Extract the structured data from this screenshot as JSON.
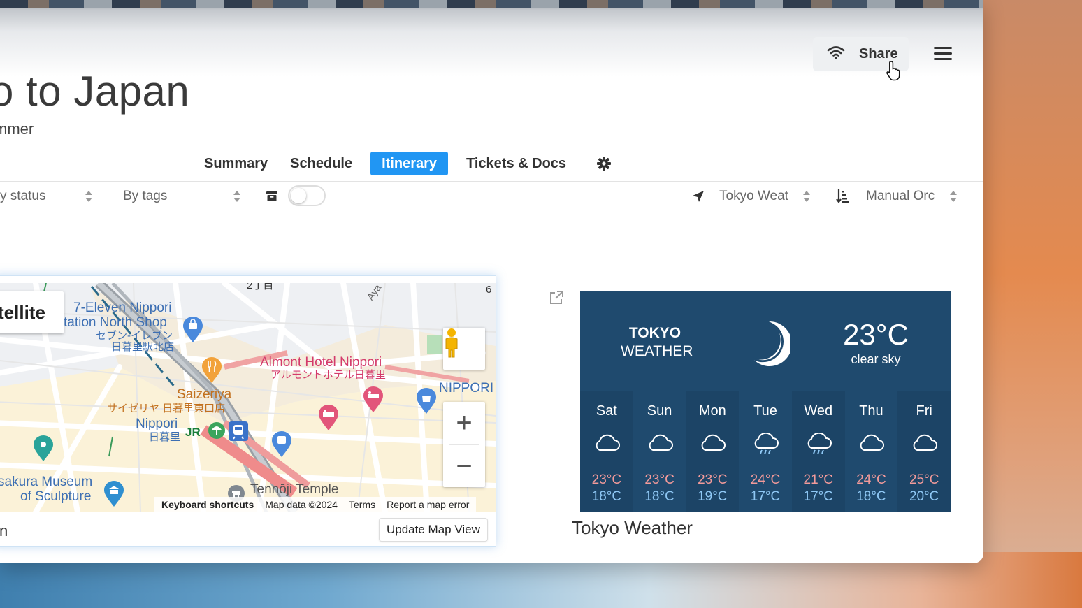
{
  "header": {
    "title": "o to Japan",
    "subtitle": "mmer",
    "share_label": "Share"
  },
  "tabs": [
    {
      "label": "Summary",
      "active": false
    },
    {
      "label": "Schedule",
      "active": false
    },
    {
      "label": "Itinerary",
      "active": true
    },
    {
      "label": "Tickets & Docs",
      "active": false
    }
  ],
  "filters": {
    "status_label": "y status",
    "tags_label": "By tags",
    "archive_toggle_on": false,
    "location_label": "Tokyo Weat",
    "order_label": "Manual Orc"
  },
  "map": {
    "satellite_label": "tellite",
    "labels": {
      "seven_eleven_1": "7-Eleven Nippori",
      "seven_eleven_2": "tation North Shop",
      "seven_eleven_jp1": "セブン-イレブン",
      "seven_eleven_jp2": "日暮里駅北店",
      "almont_en": "Almont Hotel Nippori",
      "almont_jp": "アルモントホテル日暮里",
      "saizeriya_en": "Saizeriya",
      "saizeriya_jp": "サイゼリヤ 日暮里東口店",
      "nippori_en": "Nippori",
      "nippori_jp": "日暮里",
      "nippori_right": "NIPPORI",
      "museum_1": "sakura Museum",
      "museum_2": "of Sculpture",
      "temple": "Tennōji Temple",
      "chome": "2丁目",
      "ayase": "Aya",
      "six": "6",
      "jr": "JR"
    },
    "attribution": {
      "shortcuts": "Keyboard shortcuts",
      "data": "Map data ©2024",
      "terms": "Terms",
      "report": "Report a map error"
    },
    "caption": "n",
    "update_button": "Update Map View"
  },
  "weather": {
    "city_line1": "TOKYO",
    "city_line2": "WEATHER",
    "current_temp": "23°C",
    "current_desc": "clear sky",
    "current_icon": "moon-icon",
    "days": [
      {
        "name": "Sat",
        "icon": "cloud-icon",
        "high": "23°C",
        "low": "18°C"
      },
      {
        "name": "Sun",
        "icon": "cloud-icon",
        "high": "23°C",
        "low": "18°C"
      },
      {
        "name": "Mon",
        "icon": "cloud-icon",
        "high": "23°C",
        "low": "19°C"
      },
      {
        "name": "Tue",
        "icon": "cloud-rain-icon",
        "high": "24°C",
        "low": "17°C"
      },
      {
        "name": "Wed",
        "icon": "cloud-rain-icon",
        "high": "21°C",
        "low": "17°C"
      },
      {
        "name": "Thu",
        "icon": "cloud-icon",
        "high": "24°C",
        "low": "18°C"
      },
      {
        "name": "Fri",
        "icon": "cloud-icon",
        "high": "25°C",
        "low": "20°C"
      }
    ],
    "caption": "Tokyo Weather"
  },
  "colors": {
    "accent": "#2196f3",
    "weather_bg": "#1f4a6e",
    "high_temp": "#f29a9a",
    "low_temp": "#8fc8f5"
  }
}
